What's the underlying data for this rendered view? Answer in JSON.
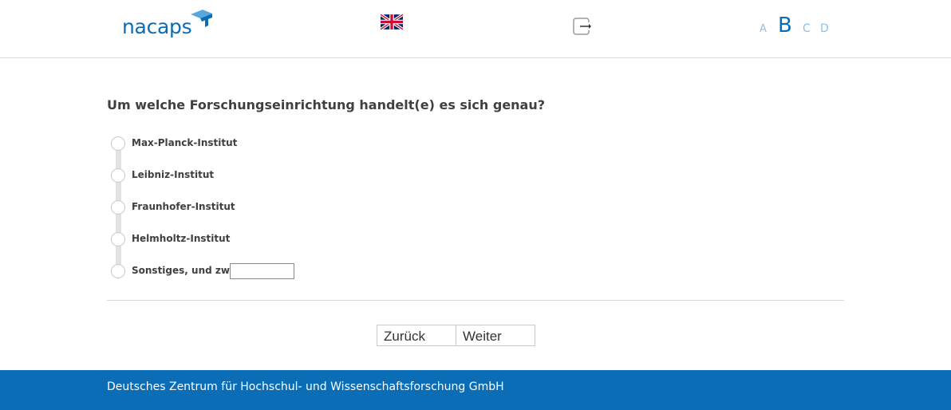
{
  "header": {
    "logo_text": "nacaps",
    "language_icon": "uk-flag-icon",
    "logout_icon": "logout-icon",
    "font_sizes": [
      "A",
      "B",
      "C",
      "D"
    ],
    "active_font_size": "B",
    "brand_color": "#0a6db5"
  },
  "question": {
    "text": "Um welche Forschungseinrichtung handelt(e) es sich genau?",
    "options": [
      {
        "label": "Max-Planck-Institut",
        "selected": false
      },
      {
        "label": "Leibniz-Institut",
        "selected": false
      },
      {
        "label": "Fraunhofer-Institut",
        "selected": false
      },
      {
        "label": "Helmholtz-Institut",
        "selected": false
      },
      {
        "label": "Sonstiges, und zwar:",
        "selected": false
      }
    ],
    "other_input_value": ""
  },
  "navigation": {
    "back_label": "Zurück",
    "next_label": "Weiter"
  },
  "footer": {
    "text": "Deutsches Zentrum für Hochschul- und Wissenschaftsforschung GmbH"
  }
}
